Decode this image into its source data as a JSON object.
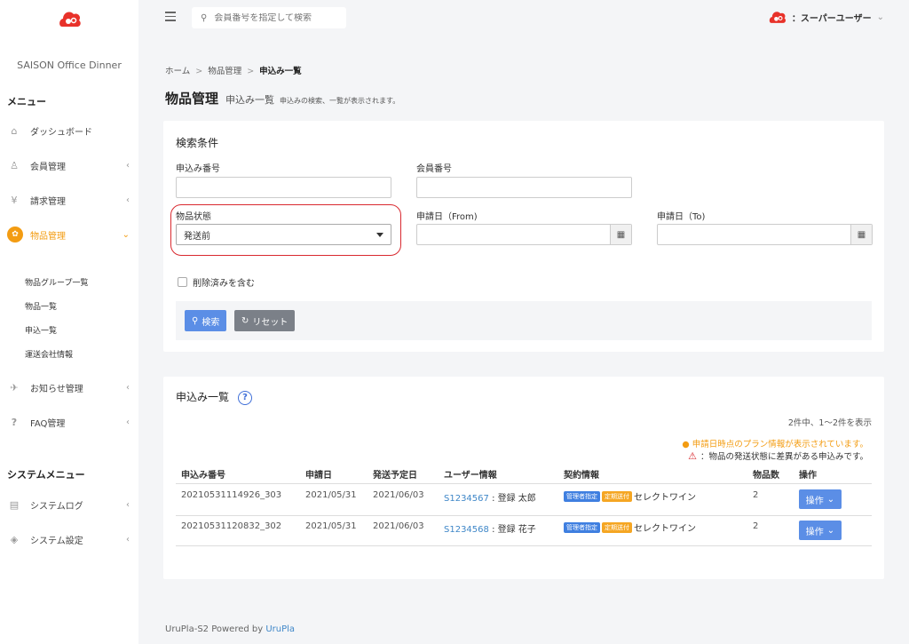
{
  "sidebar": {
    "brand": "SAISON Office Dinner",
    "menu_heading": "メニュー",
    "items": [
      {
        "label": "ダッシュボード"
      },
      {
        "label": "会員管理"
      },
      {
        "label": "請求管理"
      },
      {
        "label": "物品管理"
      },
      {
        "label": "お知らせ管理"
      },
      {
        "label": "FAQ管理"
      }
    ],
    "sub_items": [
      "物品グループ一覧",
      "物品一覧",
      "申込一覧",
      "運送会社情報"
    ],
    "system_heading": "システムメニュー",
    "system_items": [
      {
        "label": "システムログ"
      },
      {
        "label": "システム設定"
      }
    ],
    "icons": {
      "q": "?",
      "yen": "¥"
    }
  },
  "topbar": {
    "search_placeholder": "会員番号を指定して検索",
    "user_label": "：スーパーユーザー"
  },
  "breadcrumb": {
    "home": "ホーム",
    "level1": "物品管理",
    "current": "申込み一覧",
    "separator": ">"
  },
  "page": {
    "title": "物品管理",
    "subtitle": "申込み一覧",
    "description": "申込みの検索、一覧が表示されます。"
  },
  "search_form": {
    "title": "検索条件",
    "application_no_label": "申込み番号",
    "member_no_label": "会員番号",
    "status_label": "物品状態",
    "status_value": "発送前",
    "date_from_label": "申請日（From)",
    "date_to_label": "申請日（To)",
    "include_deleted_label": "削除済みを含む",
    "search_button": "検索",
    "reset_button": "リセット"
  },
  "list": {
    "title": "申込み一覧",
    "count_text": "2件中、1〜2件を表示",
    "notice_plan": "申請日時点のプラン情報が表示されています。",
    "notice_diff": "：物品の発送状態に差異がある申込みです。",
    "columns": [
      "申込み番号",
      "申請日",
      "発送予定日",
      "ユーザー情報",
      "契約情報",
      "物品数",
      "操作"
    ],
    "rows": [
      {
        "app_no": "20210531114926_303",
        "date": "2021/05/31",
        "ship_date": "2021/06/03",
        "user_id": "S1234567",
        "user_name": "登録 太郎",
        "badge1": "管理者指定",
        "badge2": "定期送付",
        "contract": "セレクトワイン",
        "qty": "2",
        "op": "操作"
      },
      {
        "app_no": "20210531120832_302",
        "date": "2021/05/31",
        "ship_date": "2021/06/03",
        "user_id": "S1234568",
        "user_name": "登録 花子",
        "badge1": "管理者指定",
        "badge2": "定期送付",
        "contract": "セレクトワイン",
        "qty": "2",
        "op": "操作"
      }
    ]
  },
  "footer": {
    "text": "UruPla-S2 Powered by ",
    "link": "UruPla"
  },
  "colors": {
    "accent": "#f39c12",
    "primary": "#5b8ee6",
    "link": "#3f87c8",
    "danger": "#d9292f"
  }
}
